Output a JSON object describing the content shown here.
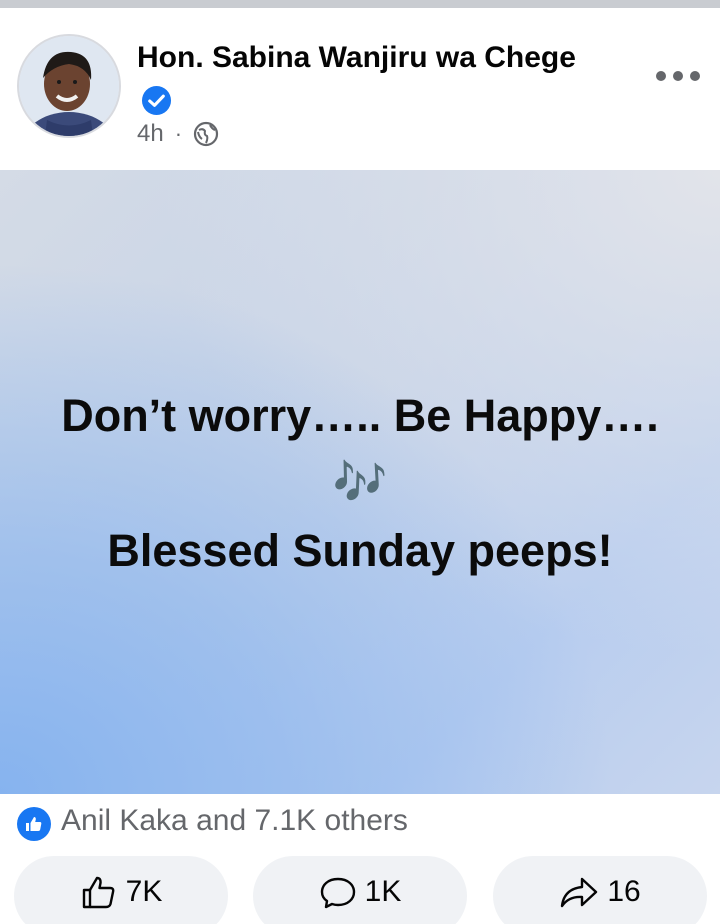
{
  "post": {
    "author": "Hon. Sabina Wanjiru wa Chege",
    "verified": true,
    "time": "4h",
    "separator": "·",
    "audience_icon": "globe-icon",
    "more_icon": "more-options-icon"
  },
  "image_text": {
    "line1": "Don’t worry….. Be Happy….",
    "notes": "🎶",
    "line3": "Blessed Sunday peeps!"
  },
  "reactions": {
    "summary": "Anil Kaka and 7.1K others",
    "icon": "like-badge-icon"
  },
  "actions": {
    "like_count": "7K",
    "comment_count": "1K",
    "share_count": "16"
  },
  "colors": {
    "brand_blue": "#1877f2",
    "secondary_text": "#65676b",
    "button_bg": "#f0f2f5"
  }
}
